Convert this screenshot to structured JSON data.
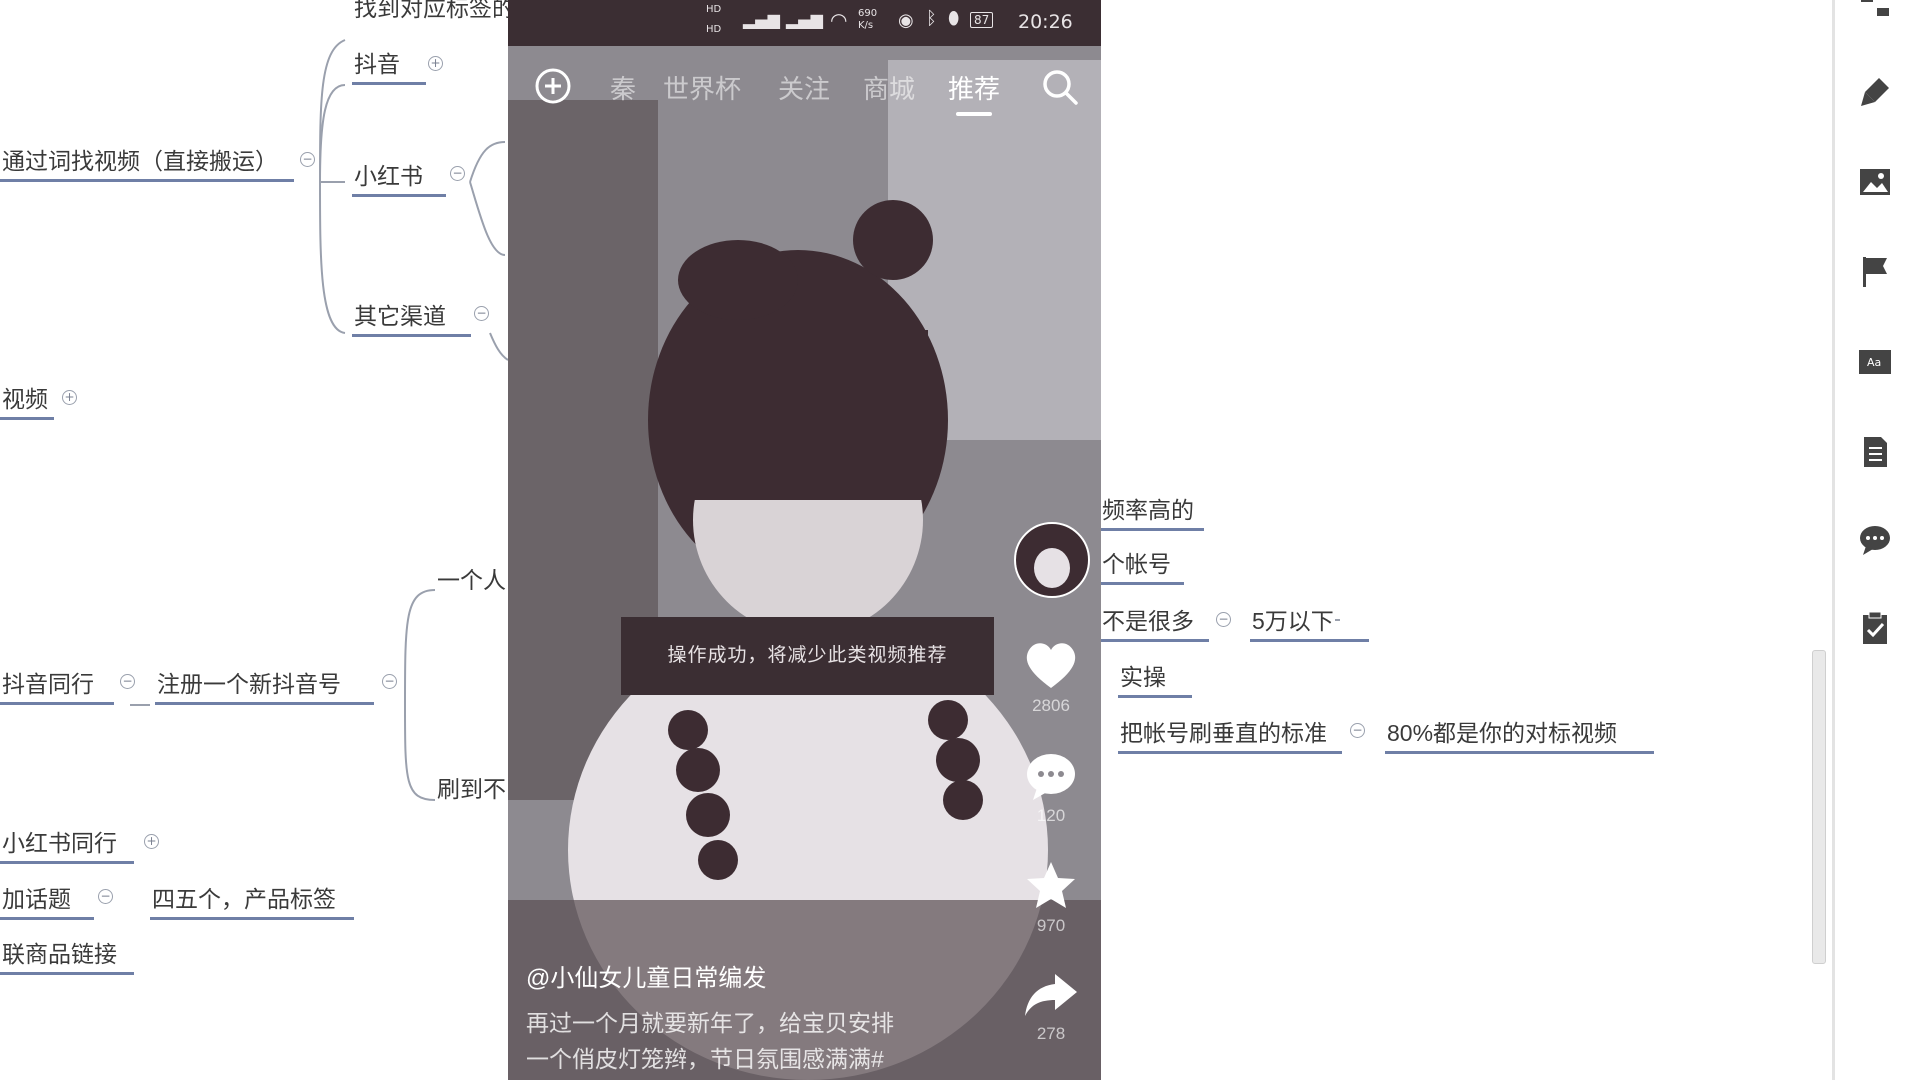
{
  "mindmap": {
    "nodes": {
      "find_tag": "找到对应标签的",
      "douyin": "抖音",
      "find_by_word": "通过词找视频（直接搬运）",
      "xiaohongshu": "小红书",
      "other_channels": "其它渠道",
      "video": "视频",
      "one_person": "一个人",
      "douyin_peer": "抖音同行",
      "register_new": "注册一个新抖音号",
      "scroll_to": "刷到不",
      "xhs_peer": "小红书同行",
      "add_topic": "加话题",
      "four_five_tags": "四五个，产品标签",
      "link_product": "联商品链接",
      "high_freq": "频率高的",
      "account": "个帐号",
      "not_many": "不是很多",
      "under_50k": "5万以下",
      "practice": "实操",
      "vertical_standard": "把帐号刷垂直的标准",
      "eighty_percent": "80%都是你的对标视频"
    },
    "toggle_symbols": {
      "expand": "+",
      "collapse": "−"
    }
  },
  "phone": {
    "status": {
      "time": "20:26",
      "battery": "87",
      "speed": "690 K/s",
      "hd": "HD"
    },
    "tabs": [
      "秦",
      "世界杯",
      "关注",
      "商城",
      "推荐"
    ],
    "active_tab": "推荐",
    "toast": "操作成功，将减少此类视频推荐",
    "counts": {
      "likes": "2806",
      "comments": "120",
      "favorites": "970",
      "shares": "278"
    },
    "author": "@小仙女儿童日常编发",
    "description_lines": [
      "再过一个月就要新年了，给宝贝安排",
      "一个俏皮灯笼辫，节日氛围感满满#"
    ]
  },
  "icons": {
    "add": "plus-circle-icon",
    "search": "search-icon",
    "like": "heart-icon",
    "comment": "comment-icon",
    "favorite": "star-icon",
    "share": "share-icon"
  },
  "colors": {
    "underline": "#6f7fa6",
    "statusbar": "#3b2e33",
    "toast_bg": "#3b2e33"
  }
}
